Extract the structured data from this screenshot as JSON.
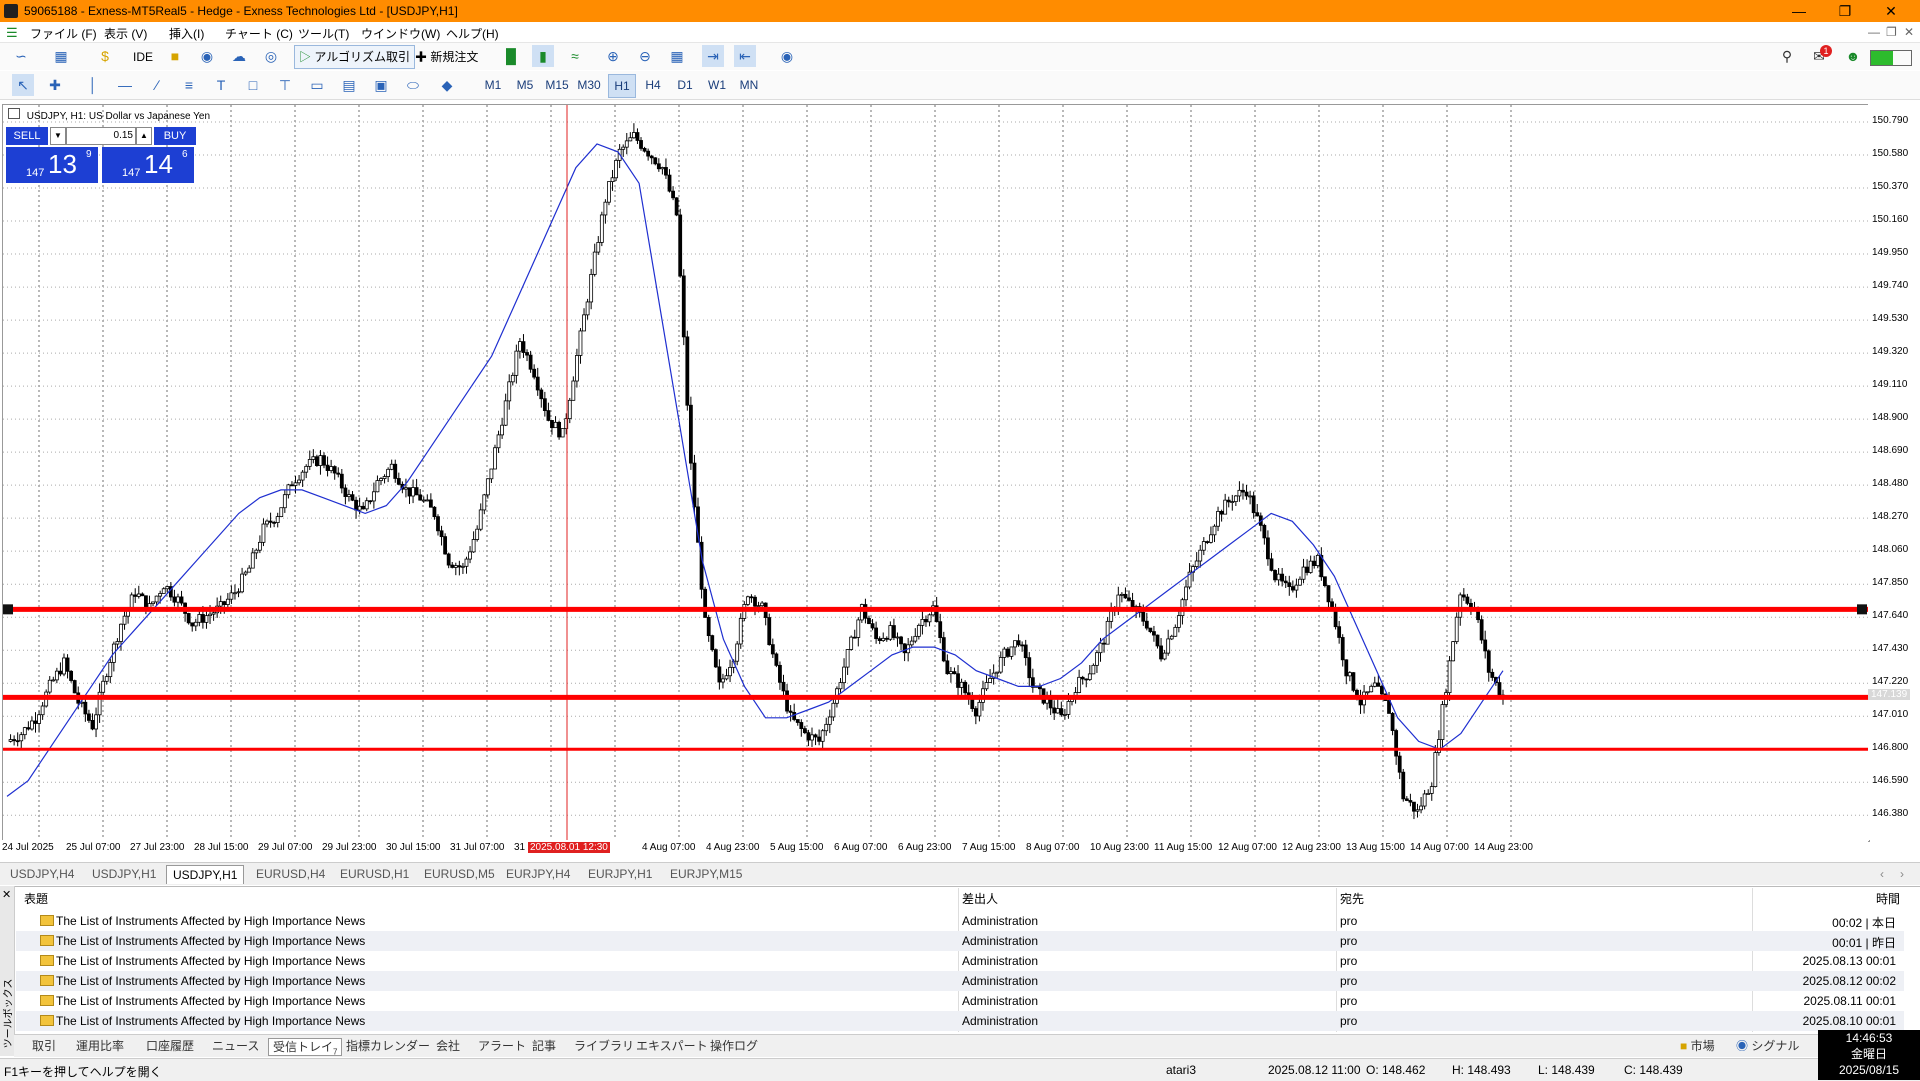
{
  "window": {
    "title": "59065188 - Exness-MT5Real5 - Hedge - Exness Technologies Ltd - [USDJPY,H1]"
  },
  "menu": [
    "ファイル (F)",
    "表示 (V)",
    "挿入(I)",
    "チャート (C)",
    "ツール(T)",
    "ウインドウ(W)",
    "ヘルプ(H)"
  ],
  "toolbar": {
    "ide": "IDE",
    "algo": "アルゴリズム取引",
    "new_order": "新規注文"
  },
  "timeframes": [
    "M1",
    "M5",
    "M15",
    "M30",
    "H1",
    "H4",
    "D1",
    "W1",
    "MN"
  ],
  "active_timeframe": "H1",
  "chart": {
    "header": "USDJPY, H1:  US Dollar vs Japanese Yen",
    "sell_label": "SELL",
    "buy_label": "BUY",
    "lot": "0.15",
    "sell_big": "147",
    "sell_pips": "13",
    "sell_sup": "9",
    "buy_big": "147",
    "buy_pips": "14",
    "buy_sup": "6",
    "current_price": "147.139",
    "highlight_time": "2025.08.01 12:30"
  },
  "chart_data": {
    "type": "candlestick",
    "symbol": "USDJPY",
    "timeframe": "H1",
    "y_ticks": [
      "150.790",
      "150.580",
      "150.370",
      "150.160",
      "149.950",
      "149.740",
      "149.530",
      "149.320",
      "149.110",
      "148.900",
      "148.690",
      "148.480",
      "148.270",
      "148.060",
      "147.850",
      "147.640",
      "147.430",
      "147.220",
      "147.010",
      "146.800",
      "146.590",
      "146.380"
    ],
    "x_ticks": [
      "24 Jul 2025",
      "25 Jul 07:00",
      "27 Jul 23:00",
      "28 Jul 15:00",
      "29 Jul 07:00",
      "29 Jul 23:00",
      "30 Jul 15:00",
      "31 Jul 07:00",
      "31",
      "15:00",
      "4 Aug 07:00",
      "4 Aug 23:00",
      "5 Aug 15:00",
      "6 Aug 07:00",
      "6 Aug 23:00",
      "7 Aug 15:00",
      "8 Aug 07:00",
      "10 Aug 23:00",
      "11 Aug 15:00",
      "12 Aug 07:00",
      "12 Aug 23:00",
      "13 Aug 15:00",
      "14 Aug 07:00",
      "14 Aug 23:00"
    ],
    "ylim": [
      146.28,
      150.86
    ],
    "horizontal_lines": [
      147.69,
      147.13,
      146.8
    ],
    "close_path": [
      146.85,
      146.9,
      147.0,
      147.2,
      147.35,
      147.1,
      146.95,
      147.3,
      147.6,
      147.8,
      147.7,
      147.85,
      147.75,
      147.6,
      147.65,
      147.7,
      147.8,
      147.95,
      148.2,
      148.3,
      148.5,
      148.6,
      148.65,
      148.55,
      148.4,
      148.3,
      148.5,
      148.6,
      148.45,
      148.4,
      148.3,
      148.0,
      147.95,
      148.2,
      148.6,
      149.0,
      149.4,
      149.2,
      148.9,
      148.8,
      149.3,
      149.8,
      150.3,
      150.6,
      150.7,
      150.6,
      150.5,
      150.2,
      148.6,
      147.6,
      147.2,
      147.4,
      147.8,
      147.7,
      147.3,
      147.0,
      146.9,
      146.85,
      147.1,
      147.4,
      147.7,
      147.5,
      147.55,
      147.4,
      147.6,
      147.7,
      147.3,
      147.2,
      147.05,
      147.25,
      147.4,
      147.5,
      147.2,
      147.1,
      147.0,
      147.2,
      147.3,
      147.5,
      147.8,
      147.7,
      147.6,
      147.4,
      147.6,
      147.9,
      148.1,
      148.3,
      148.4,
      148.45,
      148.2,
      147.9,
      147.8,
      147.95,
      148.0,
      147.7,
      147.3,
      147.1,
      147.2,
      147.05,
      146.5,
      146.4,
      146.6,
      147.2,
      147.8,
      147.7,
      147.3,
      147.13
    ],
    "ma_path": [
      146.5,
      146.6,
      146.8,
      147.0,
      147.2,
      147.4,
      147.55,
      147.7,
      147.85,
      148.0,
      148.15,
      148.3,
      148.4,
      148.45,
      148.45,
      148.4,
      148.35,
      148.3,
      148.35,
      148.5,
      148.7,
      148.9,
      149.1,
      149.3,
      149.6,
      149.9,
      150.2,
      150.5,
      150.65,
      150.6,
      150.4,
      149.6,
      148.8,
      148.0,
      147.5,
      147.2,
      147.0,
      147.0,
      147.05,
      147.1,
      147.2,
      147.3,
      147.4,
      147.45,
      147.45,
      147.4,
      147.3,
      147.25,
      147.2,
      147.2,
      147.25,
      147.35,
      147.5,
      147.6,
      147.7,
      147.8,
      147.9,
      148.0,
      148.1,
      148.2,
      148.3,
      148.25,
      148.1,
      147.9,
      147.6,
      147.3,
      147.0,
      146.85,
      146.8,
      146.9,
      147.1,
      147.3
    ]
  },
  "chart_tabs": [
    "USDJPY,H4",
    "USDJPY,H1",
    "USDJPY,H1",
    "EURUSD,H4",
    "EURUSD,H1",
    "EURUSD,M5",
    "EURJPY,H4",
    "EURJPY,H1",
    "EURJPY,M15"
  ],
  "active_chart_tab": 2,
  "toolbox": {
    "side_label": "ツールボックス",
    "headers": {
      "subject": "表題",
      "sender": "差出人",
      "recipient": "宛先",
      "time": "時間"
    },
    "messages": [
      {
        "subject": "The List of Instruments Affected by High Importance News",
        "sender": "Administration",
        "recipient": "pro",
        "time": "00:02 | 本日"
      },
      {
        "subject": "The List of Instruments Affected by High Importance News",
        "sender": "Administration",
        "recipient": "pro",
        "time": "00:01 | 昨日"
      },
      {
        "subject": "The List of Instruments Affected by High Importance News",
        "sender": "Administration",
        "recipient": "pro",
        "time": "2025.08.13 00:01"
      },
      {
        "subject": "The List of Instruments Affected by High Importance News",
        "sender": "Administration",
        "recipient": "pro",
        "time": "2025.08.12 00:02"
      },
      {
        "subject": "The List of Instruments Affected by High Importance News",
        "sender": "Administration",
        "recipient": "pro",
        "time": "2025.08.11 00:01"
      },
      {
        "subject": "The List of Instruments Affected by High Importance News",
        "sender": "Administration",
        "recipient": "pro",
        "time": "2025.08.10 00:01"
      }
    ],
    "tabs": [
      "取引",
      "運用比率",
      "口座履歴",
      "ニュース",
      "受信トレイ",
      "指標カレンダー",
      "会社",
      "アラート",
      "記事",
      "ライブラリ",
      "エキスパート",
      "操作ログ"
    ],
    "active_tab": 4,
    "inbox_badge": "7",
    "right": {
      "market": "市場",
      "signal": "シグナル"
    }
  },
  "status": {
    "help": "F1キーを押してヘルプを開く",
    "profile": "atari3",
    "time": "2025.08.12 11:00",
    "open": "O: 148.462",
    "high": "H: 148.493",
    "low": "L: 148.439",
    "close": "C: 148.439"
  },
  "clock": {
    "time": "14:46:53",
    "day": "金曜日",
    "date": "2025/08/15"
  },
  "notification_count": "1",
  "colors": {
    "title_bar": "#ff8c00",
    "hline": "#ff0000",
    "ma": "#1f2fd0",
    "trade_panel": "#1d3fd3"
  }
}
